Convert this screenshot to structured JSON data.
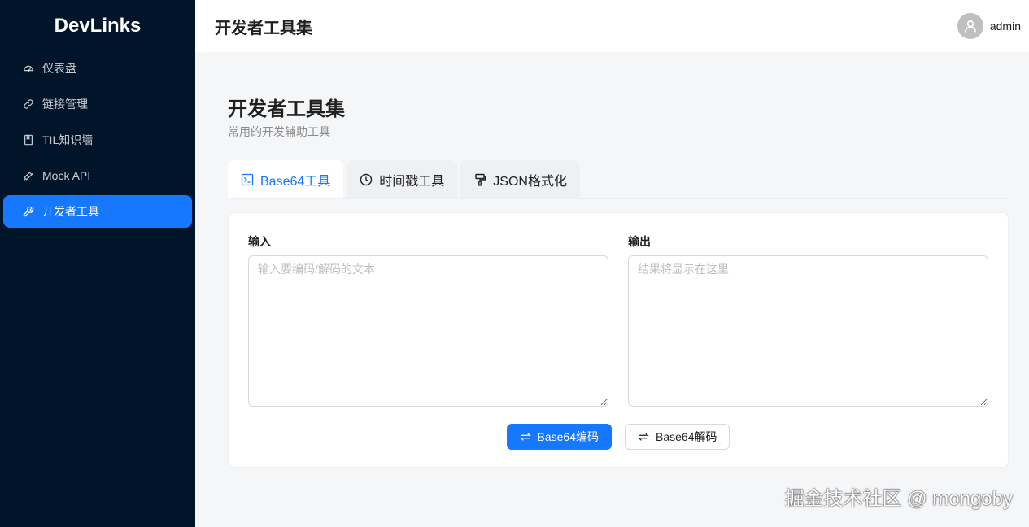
{
  "app": {
    "logo": "DevLinks"
  },
  "sidebar": {
    "items": [
      {
        "label": "仪表盘",
        "icon": "dashboard-icon"
      },
      {
        "label": "链接管理",
        "icon": "link-icon"
      },
      {
        "label": "TIL知识墙",
        "icon": "book-icon"
      },
      {
        "label": "Mock API",
        "icon": "api-icon"
      },
      {
        "label": "开发者工具",
        "icon": "tool-icon",
        "active": true
      }
    ]
  },
  "header": {
    "title": "开发者工具集",
    "username": "admin"
  },
  "page": {
    "title": "开发者工具集",
    "subtitle": "常用的开发辅助工具"
  },
  "tabs": [
    {
      "label": "Base64工具",
      "icon": "code-icon",
      "active": true
    },
    {
      "label": "时间戳工具",
      "icon": "clock-icon"
    },
    {
      "label": "JSON格式化",
      "icon": "format-painter-icon"
    }
  ],
  "base64": {
    "input_label": "输入",
    "input_placeholder": "输入要编码/解码的文本",
    "output_label": "输出",
    "output_placeholder": "结果将显示在这里",
    "encode_label": "Base64编码",
    "decode_label": "Base64解码"
  },
  "watermark": "掘金技术社区 @ mongoby",
  "colors": {
    "sidebar_bg": "#001529",
    "primary": "#1677ff"
  }
}
